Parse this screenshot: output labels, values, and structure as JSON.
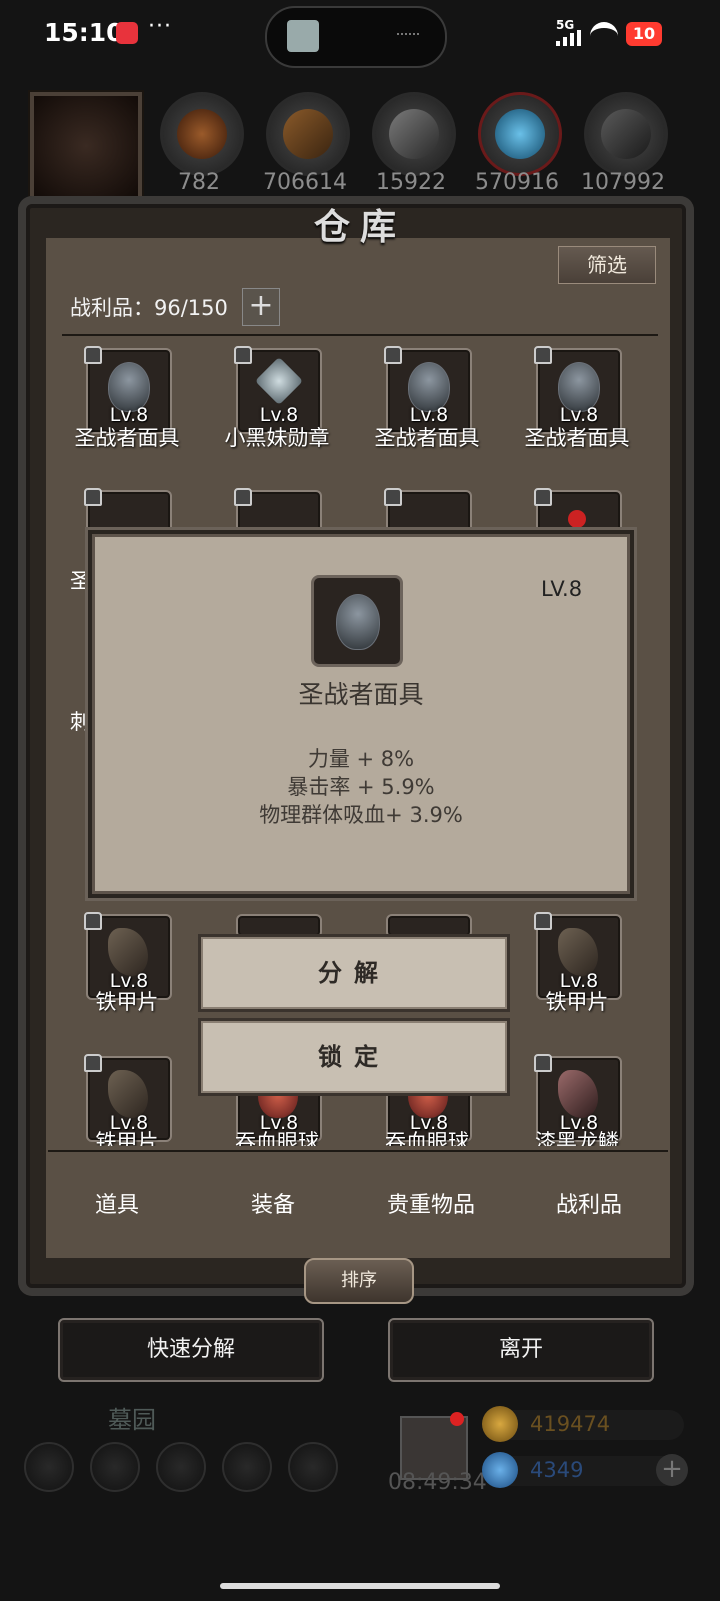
{
  "status_bar": {
    "time": "15:10",
    "dots": "···",
    "network": "5G",
    "battery": "10"
  },
  "resources": [
    "782",
    "706614",
    "15922",
    "570916",
    "107992"
  ],
  "panel": {
    "title": "仓库",
    "filter_label": "筛选",
    "capacity_label": "战利品：96/150",
    "plus": "+"
  },
  "items_row1": [
    {
      "name": "圣战者面具",
      "lv": "Lv.8"
    },
    {
      "name": "小黑妹勋章",
      "lv": "Lv.8"
    },
    {
      "name": "圣战者面具",
      "lv": "Lv.8"
    },
    {
      "name": "圣战者面具",
      "lv": "Lv.8"
    }
  ],
  "row2_left_fragment": "圣",
  "row3_left_fragment": "刺",
  "items_row4": [
    {
      "name": "铁甲片",
      "lv": "Lv.8"
    },
    {
      "name": "铁甲片",
      "lv": "Lv.8"
    }
  ],
  "items_row5": [
    {
      "name": "铁甲片",
      "lv": "Lv.8"
    },
    {
      "name": "吞血眼球",
      "lv": "Lv.8"
    },
    {
      "name": "吞血眼球",
      "lv": "Lv.8"
    },
    {
      "name": "漆黑龙鳞",
      "lv": "Lv.8"
    }
  ],
  "popup": {
    "level": "LV.8",
    "name": "圣战者面具",
    "stats": [
      "力量 + 8%",
      "暴击率 + 5.9%",
      "物理群体吸血+ 3.9%"
    ],
    "decompose_label": "分解",
    "lock_label": "锁定"
  },
  "tabs": [
    "道具",
    "装备",
    "贵重物品",
    "战利品"
  ],
  "sort_label": "排序",
  "quick_decompose_label": "快速分解",
  "leave_label": "离开",
  "hud": {
    "area_name": "墓园",
    "timer": "08:49:34",
    "gold": "419474",
    "gems": "4349",
    "plus": "+"
  },
  "colors": {
    "gold_text": "#b3862b",
    "gem_text": "#3c6ea8",
    "paper": "#b4aa9c"
  }
}
